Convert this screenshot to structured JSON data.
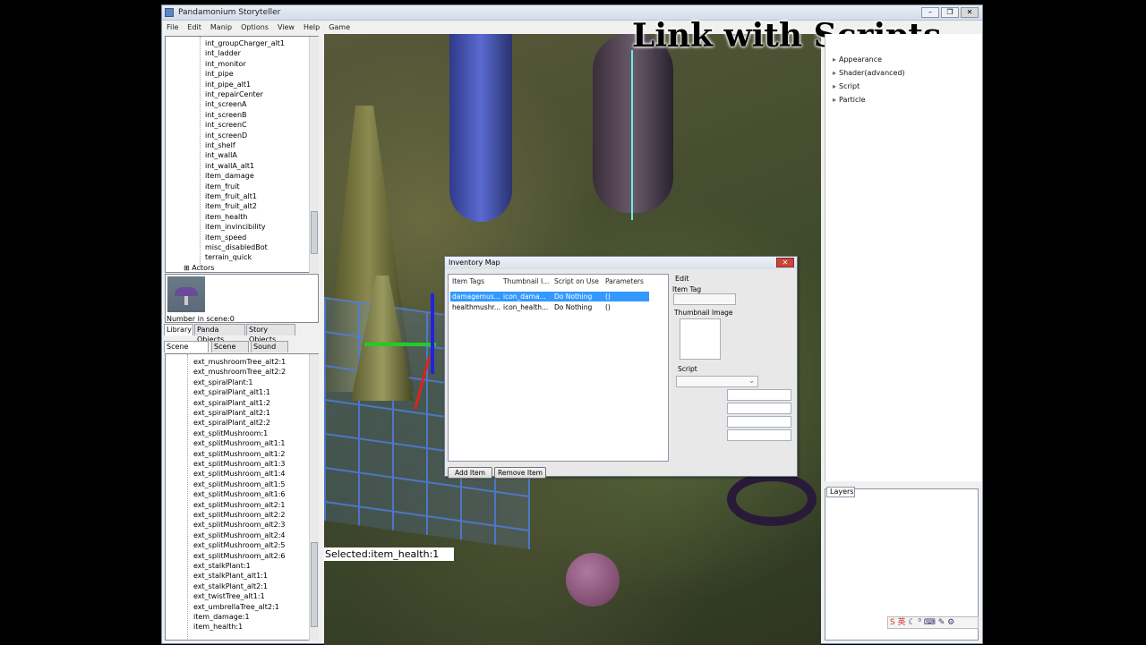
{
  "window": {
    "title": "Pandamonium Storyteller"
  },
  "menu": [
    "File",
    "Edit",
    "Manip",
    "Options",
    "View",
    "Help",
    "Game"
  ],
  "overlay_title": "Link with Scripts",
  "library_tree": {
    "items": [
      "int_groupCharger_alt1",
      "int_ladder",
      "int_monitor",
      "int_pipe",
      "int_pipe_alt1",
      "int_repairCenter",
      "int_screenA",
      "int_screenB",
      "int_screenC",
      "int_screenD",
      "int_shelf",
      "int_wallA",
      "int_wallA_alt1",
      "item_damage",
      "item_fruit",
      "item_fruit_alt1",
      "item_fruit_alt2",
      "item_health",
      "item_invincibility",
      "item_speed",
      "misc_disabledBot",
      "terrain_quick"
    ],
    "actors_label": "Actors"
  },
  "number_in_scene": "Number in scene:0",
  "library_tabs": [
    "Library",
    "Panda Objects",
    "Story Objects"
  ],
  "scene_tabs": [
    "Scene Graph",
    "Scene List",
    "Sound List"
  ],
  "scene_graph": [
    "ext_mushroomTree_alt2:1",
    "ext_mushroomTree_alt2:2",
    "ext_spiralPlant:1",
    "ext_spiralPlant_alt1:1",
    "ext_spiralPlant_alt1:2",
    "ext_spiralPlant_alt2:1",
    "ext_spiralPlant_alt2:2",
    "ext_splitMushroom:1",
    "ext_splitMushroom_alt1:1",
    "ext_splitMushroom_alt1:2",
    "ext_splitMushroom_alt1:3",
    "ext_splitMushroom_alt1:4",
    "ext_splitMushroom_alt1:5",
    "ext_splitMushroom_alt1:6",
    "ext_splitMushroom_alt2:1",
    "ext_splitMushroom_alt2:2",
    "ext_splitMushroom_alt2:3",
    "ext_splitMushroom_alt2:4",
    "ext_splitMushroom_alt2:5",
    "ext_splitMushroom_alt2:6",
    "ext_stalkPlant:1",
    "ext_stalkPlant_alt1:1",
    "ext_stalkPlant_alt2:1",
    "ext_twistTree_alt1:1",
    "ext_umbrellaTree_alt2:1",
    "item_damage:1",
    "item_health:1"
  ],
  "viewport": {
    "selected_label": "Selected:item_health:1"
  },
  "dialog": {
    "title": "Inventory Map",
    "close": "✕",
    "columns": [
      "Item Tags",
      "Thumbnail I...",
      "Script on Use",
      "Parameters"
    ],
    "rows": [
      {
        "tag": "damagemus...",
        "thumb": "icon_dama...",
        "script": "Do Nothing",
        "params": "()"
      },
      {
        "tag": "healthmushr...",
        "thumb": "icon_health...",
        "script": "Do Nothing",
        "params": "()"
      }
    ],
    "add_item": "Add Item",
    "remove_item": "Remove Item",
    "edit_label": "Edit",
    "item_tag_label": "Item Tag",
    "thumbnail_label": "Thumbnail Image",
    "script_label": "Script"
  },
  "right_panel": {
    "items": [
      "Appearance",
      "Shader(advanced)",
      "Script",
      "Particle"
    ]
  },
  "layers": {
    "tab": "Layers"
  },
  "ime": {
    "text": "英"
  }
}
